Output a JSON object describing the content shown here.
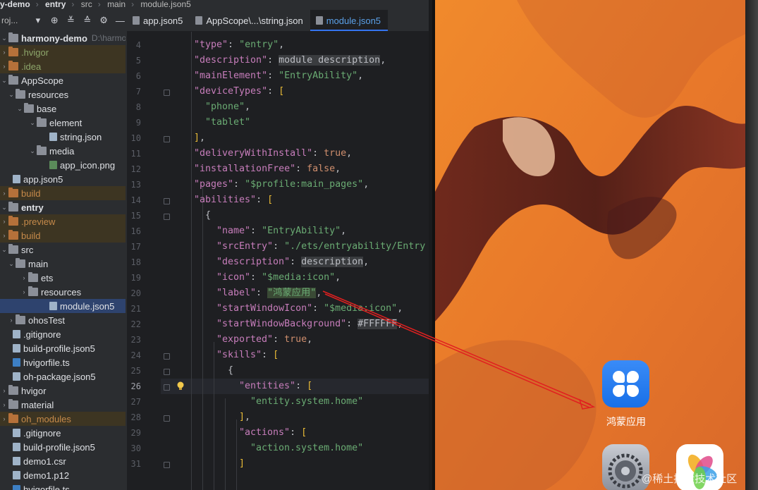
{
  "breadcrumb": {
    "project": "y-demo",
    "module": "entry",
    "dir1": "src",
    "dir2": "main",
    "file": "module.json5"
  },
  "project_panel": {
    "title": "roj..."
  },
  "tree": [
    {
      "label": "harmony-demo",
      "path": "D:\\harmonyC",
      "chev": "v",
      "icon": "folder",
      "style": "bold"
    },
    {
      "label": ".hvigor",
      "chev": ">",
      "icon": "folder-orange",
      "style": "green"
    },
    {
      "label": ".idea",
      "chev": ">",
      "icon": "folder-orange",
      "style": "green"
    },
    {
      "label": "AppScope",
      "chev": "v",
      "icon": "folder",
      "style": ""
    },
    {
      "label": "resources",
      "chev": "v",
      "icon": "folder",
      "style": ""
    },
    {
      "label": "base",
      "chev": "v",
      "icon": "folder",
      "style": ""
    },
    {
      "label": "element",
      "chev": "v",
      "icon": "folder",
      "style": ""
    },
    {
      "label": "string.json",
      "chev": "",
      "icon": "file",
      "style": ""
    },
    {
      "label": "media",
      "chev": "v",
      "icon": "folder",
      "style": ""
    },
    {
      "label": "app_icon.png",
      "chev": "",
      "icon": "file-img",
      "style": ""
    },
    {
      "label": "app.json5",
      "chev": "",
      "icon": "file",
      "style": ""
    },
    {
      "label": "build",
      "chev": ">",
      "icon": "folder-orange",
      "style": "orange"
    },
    {
      "label": "entry",
      "chev": "v",
      "icon": "folder",
      "style": "bold"
    },
    {
      "label": ".preview",
      "chev": ">",
      "icon": "folder-orange",
      "style": "orange"
    },
    {
      "label": "build",
      "chev": ">",
      "icon": "folder-orange",
      "style": "orange"
    },
    {
      "label": "src",
      "chev": "v",
      "icon": "folder",
      "style": ""
    },
    {
      "label": "main",
      "chev": "v",
      "icon": "folder",
      "style": ""
    },
    {
      "label": "ets",
      "chev": ">",
      "icon": "folder",
      "style": ""
    },
    {
      "label": "resources",
      "chev": ">",
      "icon": "folder",
      "style": ""
    },
    {
      "label": "module.json5",
      "chev": "",
      "icon": "file",
      "style": ""
    },
    {
      "label": "ohosTest",
      "chev": ">",
      "icon": "folder",
      "style": ""
    },
    {
      "label": ".gitignore",
      "chev": "",
      "icon": "file",
      "style": ""
    },
    {
      "label": "build-profile.json5",
      "chev": "",
      "icon": "file",
      "style": ""
    },
    {
      "label": "hvigorfile.ts",
      "chev": "",
      "icon": "file-ts",
      "style": ""
    },
    {
      "label": "oh-package.json5",
      "chev": "",
      "icon": "file",
      "style": ""
    },
    {
      "label": "hvigor",
      "chev": ">",
      "icon": "folder",
      "style": ""
    },
    {
      "label": "material",
      "chev": ">",
      "icon": "folder",
      "style": ""
    },
    {
      "label": "oh_modules",
      "chev": ">",
      "icon": "folder-orange",
      "style": "orange"
    },
    {
      "label": ".gitignore",
      "chev": "",
      "icon": "file",
      "style": ""
    },
    {
      "label": "build-profile.json5",
      "chev": "",
      "icon": "file",
      "style": ""
    },
    {
      "label": "demo1.csr",
      "chev": "",
      "icon": "file",
      "style": ""
    },
    {
      "label": "demo1.p12",
      "chev": "",
      "icon": "file",
      "style": ""
    },
    {
      "label": "hvigorfile.ts",
      "chev": "",
      "icon": "file-ts",
      "style": ""
    }
  ],
  "tabs": [
    {
      "label": "app.json5"
    },
    {
      "label": "AppScope\\...\\string.json"
    },
    {
      "label": "module.json5"
    }
  ],
  "code": [
    {
      "n": "4",
      "t": "\"type\": \"entry\","
    },
    {
      "n": "5",
      "t": "\"description\": module description,"
    },
    {
      "n": "6",
      "t": "\"mainElement\": \"EntryAbility\","
    },
    {
      "n": "7",
      "t": "\"deviceTypes\": ["
    },
    {
      "n": "8",
      "t": "\"phone\","
    },
    {
      "n": "9",
      "t": "\"tablet\""
    },
    {
      "n": "10",
      "t": "],"
    },
    {
      "n": "11",
      "t": "\"deliveryWithInstall\": true,"
    },
    {
      "n": "12",
      "t": "\"installationFree\": false,"
    },
    {
      "n": "13",
      "t": "\"pages\": \"$profile:main_pages\","
    },
    {
      "n": "14",
      "t": "\"abilities\": ["
    },
    {
      "n": "15",
      "t": "{"
    },
    {
      "n": "16",
      "t": "\"name\": \"EntryAbility\","
    },
    {
      "n": "17",
      "t": "\"srcEntry\": \"./ets/entryability/Entry"
    },
    {
      "n": "18",
      "t": "\"description\": description,"
    },
    {
      "n": "19",
      "t": "\"icon\": \"$media:icon\","
    },
    {
      "n": "20",
      "t": "\"label\": \"鸿蒙应用\","
    },
    {
      "n": "21",
      "t": "\"startWindowIcon\": \"$media:icon\","
    },
    {
      "n": "22",
      "t": "\"startWindowBackground\": #FFFFFF,"
    },
    {
      "n": "23",
      "t": "\"exported\": true,"
    },
    {
      "n": "24",
      "t": "\"skills\": ["
    },
    {
      "n": "25",
      "t": "{"
    },
    {
      "n": "26",
      "t": "\"entities\": ["
    },
    {
      "n": "27",
      "t": "\"entity.system.home\""
    },
    {
      "n": "28",
      "t": "],"
    },
    {
      "n": "29",
      "t": "\"actions\": ["
    },
    {
      "n": "30",
      "t": "\"action.system.home\""
    },
    {
      "n": "31",
      "t": "]"
    }
  ],
  "phone": {
    "app_label": "鸿蒙应用"
  },
  "watermark": "@稀土掘金技术社区",
  "colors": {
    "accent": "#3574f0",
    "key": "#c77dbb",
    "string": "#6aab73",
    "keyword": "#cf8e6d",
    "arrow": "#e02020"
  }
}
